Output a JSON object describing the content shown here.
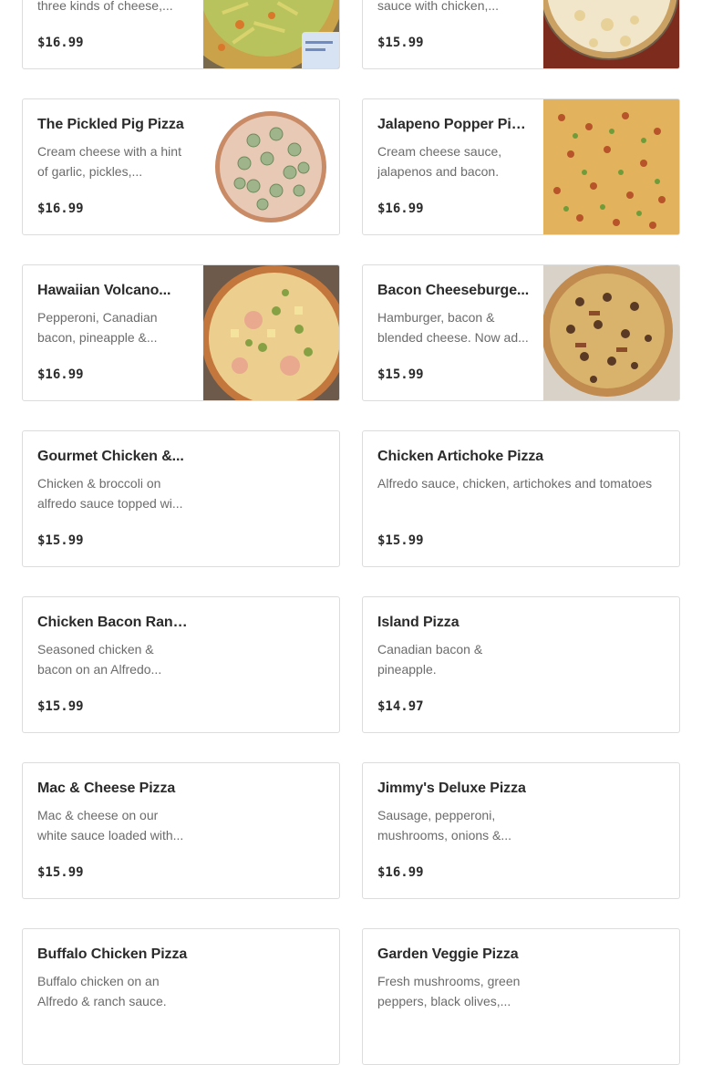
{
  "menu": {
    "items": [
      {
        "name": "",
        "description": "three kinds of cheese,...",
        "price": "$16.99",
        "image": "taco-pizza-photo"
      },
      {
        "name": "",
        "description": "sauce with chicken,...",
        "price": "$15.99",
        "image": "chicken-alfredo-pizza-photo"
      },
      {
        "name": "The Pickled Pig Pizza",
        "description": "Cream cheese with a hint of garlic, pickles,...",
        "price": "$16.99",
        "image": "pickled-pig-pizza-photo"
      },
      {
        "name": "Jalapeno Popper Pizza",
        "description": "Cream cheese sauce, jalapenos and bacon.",
        "price": "$16.99",
        "image": "jalapeno-popper-pizza-photo"
      },
      {
        "name": "Hawaiian Volcano...",
        "description": "Pepperoni, Canadian bacon, pineapple &...",
        "price": "$16.99",
        "image": "hawaiian-volcano-pizza-photo"
      },
      {
        "name": "Bacon Cheeseburge...",
        "description": "Hamburger, bacon & blended cheese. Now ad...",
        "price": "$15.99",
        "image": "bacon-cheeseburger-pizza-photo"
      },
      {
        "name": "Gourmet Chicken &...",
        "description": "Chicken & broccoli on alfredo sauce topped wi...",
        "price": "$15.99"
      },
      {
        "name": "Chicken Artichoke Pizza",
        "description": "Alfredo sauce, chicken, artichokes and tomatoes",
        "price": "$15.99"
      },
      {
        "name": "Chicken Bacon Ranc...",
        "description": "Seasoned chicken & bacon on an Alfredo...",
        "price": "$15.99"
      },
      {
        "name": "Island Pizza",
        "description": "Canadian bacon & pineapple.",
        "price": "$14.97"
      },
      {
        "name": "Mac & Cheese Pizza",
        "description": "Mac & cheese on our white sauce loaded with...",
        "price": "$15.99"
      },
      {
        "name": "Jimmy's Deluxe Pizza",
        "description": "Sausage, pepperoni, mushrooms, onions &...",
        "price": "$16.99"
      },
      {
        "name": "Buffalo Chicken Pizza",
        "description": "Buffalo chicken on an Alfredo & ranch sauce.",
        "price": ""
      },
      {
        "name": "Garden Veggie Pizza",
        "description": "Fresh mushrooms, green peppers, black olives,...",
        "price": ""
      }
    ]
  }
}
